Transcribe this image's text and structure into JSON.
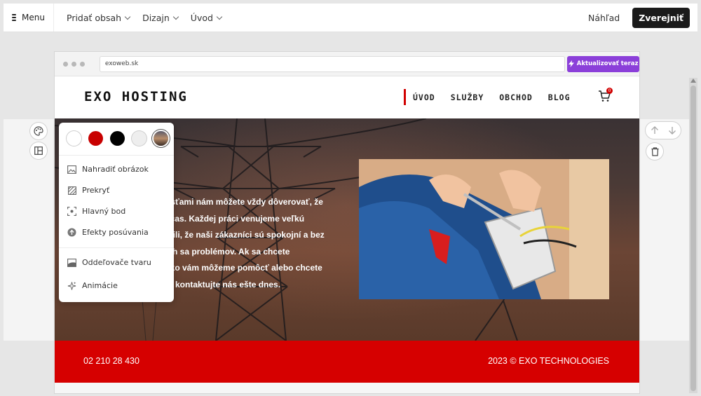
{
  "toolbar": {
    "menu_label": "Menu",
    "items": [
      "Pridať obsah",
      "Dizajn",
      "Úvod"
    ],
    "preview_label": "Náhľad",
    "publish_label": "Zverejniť"
  },
  "browser": {
    "url": "exoweb.sk",
    "upgrade_label": "Aktualizovať teraz",
    "accent_color": "#8b3fd9"
  },
  "site": {
    "logo": "EXO HOSTING",
    "nav": [
      "ÚVOD",
      "SLUŽBY",
      "OBCHOD",
      "BLOG"
    ],
    "cart_count": "0",
    "hero_lines": [
      "osťami nám môžete vždy dôverovať, že",
      "včas. Každej práci venujeme veľkú",
      "stili, že naši zákazníci sú spokojní a bez",
      "ich sa problémov. Ak sa chcete",
      "ako vám môžeme pomôcť alebo chcete",
      "u, kontaktujte nás ešte dnes."
    ],
    "footer_phone": "02 210 28 430",
    "footer_copyright": "2023 © EXO TECHNOLOGIES",
    "brand_color": "#d60000"
  },
  "popover": {
    "swatch_colors": [
      "#ffffff",
      "#c80000",
      "#000000",
      "#eeeeee"
    ],
    "items": [
      {
        "label": "Nahradiť obrázok",
        "icon": "image-icon"
      },
      {
        "label": "Prekryť",
        "icon": "overlay-icon"
      },
      {
        "label": "Hlavný bod",
        "icon": "focal-point-icon"
      },
      {
        "label": "Efekty posúvania",
        "icon": "scroll-effect-icon"
      },
      {
        "label": "Oddeľovače tvaru",
        "icon": "shape-divider-icon"
      },
      {
        "label": "Animácie",
        "icon": "sparkle-icon"
      }
    ]
  }
}
